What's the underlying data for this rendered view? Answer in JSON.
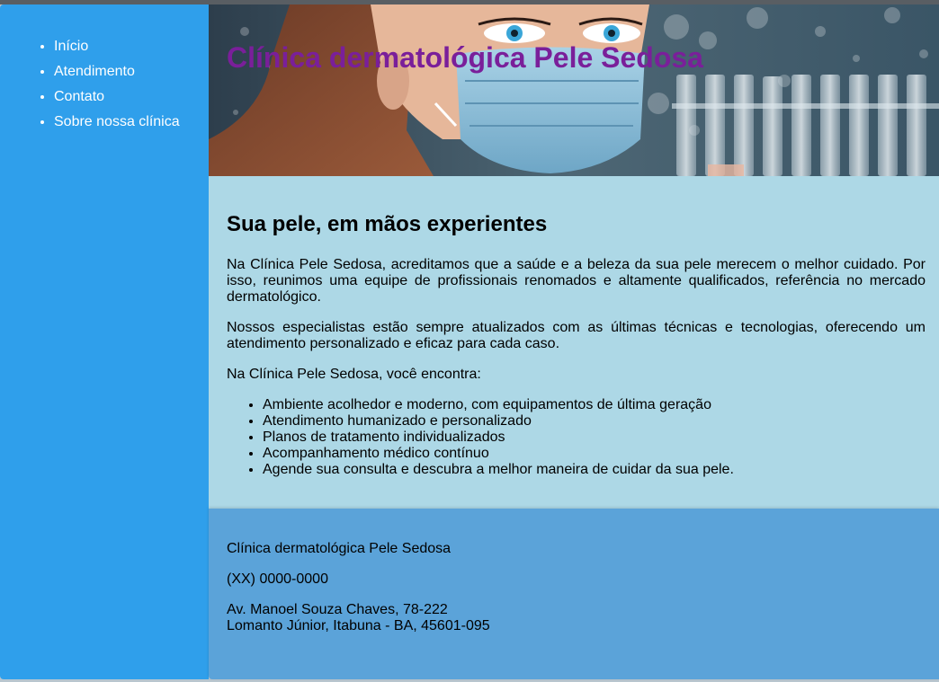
{
  "nav": {
    "items": [
      {
        "label": "Início"
      },
      {
        "label": "Atendimento"
      },
      {
        "label": "Contato"
      },
      {
        "label": "Sobre nossa clínica"
      }
    ]
  },
  "banner": {
    "title": "Clínica dermatológica Pele Sedosa"
  },
  "main": {
    "heading": "Sua pele, em mãos experientes",
    "paragraphs": [
      "Na Clínica Pele Sedosa, acreditamos que a saúde e a beleza da sua pele merecem o melhor cuidado. Por isso, reunimos uma equipe de profissionais renomados e altamente qualificados, referência no mercado dermatológico.",
      "Nossos especialistas estão sempre atualizados com as últimas técnicas e tecnologias, oferecendo um atendimento personalizado e eficaz para cada caso.",
      "Na Clínica Pele Sedosa, você encontra:"
    ],
    "features": [
      "Ambiente acolhedor e moderno, com equipamentos de última geração",
      "Atendimento humanizado e personalizado",
      "Planos de tratamento individualizados",
      "Acompanhamento médico contínuo",
      "Agende sua consulta e descubra a melhor maneira de cuidar da sua pele."
    ]
  },
  "footer": {
    "name": "Clínica dermatológica Pele Sedosa",
    "phone": "(XX) 0000-0000",
    "address_line1": "Av. Manoel Souza Chaves, 78-222",
    "address_line2": "Lomanto Júnior, Itabuna - BA, 45601-095"
  },
  "colors": {
    "sidebar": "#2f9feb",
    "content_bg": "#add8e6",
    "footer_bg": "#5ba3d9",
    "title": "#7a1f9a"
  }
}
